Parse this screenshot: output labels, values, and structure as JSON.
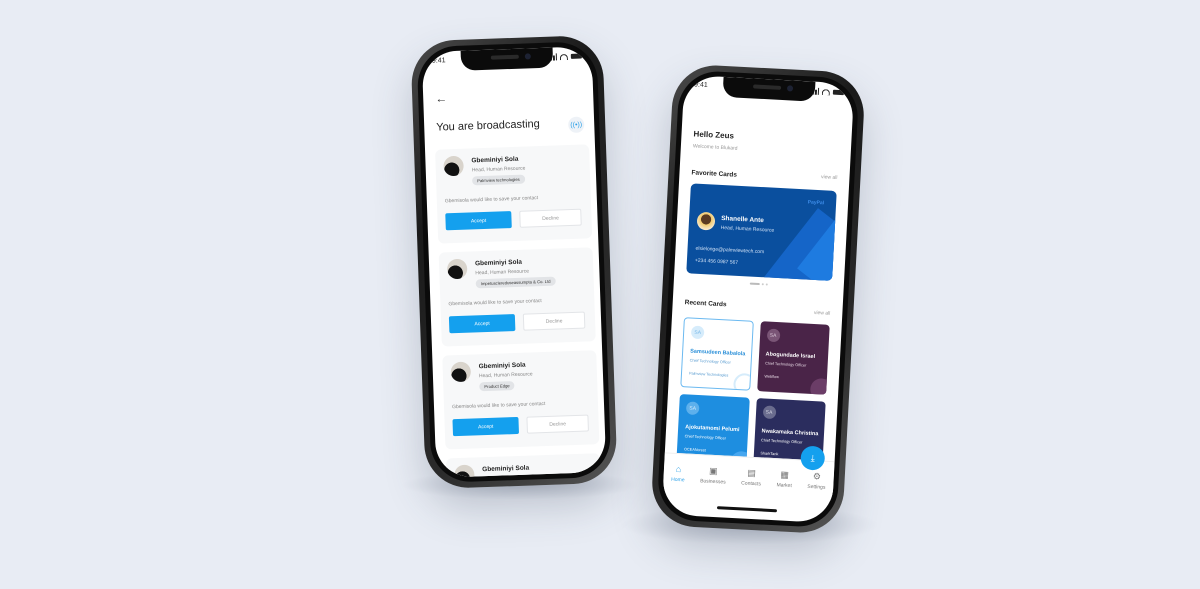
{
  "status_bar": {
    "time": "9:41"
  },
  "broadcast_screen": {
    "back_label": "←",
    "title": "You are broadcasting",
    "broadcast_icon": "((•))",
    "requests": [
      {
        "name": "Gbeminiyi Sola",
        "role": "Head, Human Resource",
        "company": "Palmview technologies",
        "message": "Gbemisola would like to save your contact",
        "accept_label": "Accept",
        "decline_label": "Decline"
      },
      {
        "name": "Gbeminiyi Sola",
        "role": "Head, Human Resource",
        "company": "Impetusclereduseassumpta & Co. Ltd",
        "message": "Gbemisola would like to save your contact",
        "accept_label": "Accept",
        "decline_label": "Decline"
      },
      {
        "name": "Gbeminiyi Sola",
        "role": "Head, Human Resource",
        "company": "Product Edge",
        "message": "Gbemisola would like to save your contact",
        "accept_label": "Accept",
        "decline_label": "Decline"
      },
      {
        "name": "Gbeminiyi Sola"
      }
    ]
  },
  "home_screen": {
    "greeting": "Hello Zeus",
    "welcome": "Welcome to Blukard",
    "favorite_title": "Favorite Cards",
    "favorite_view_all": "view all",
    "favorite_card": {
      "brand": "PayPal",
      "name": "Shanelle Ante",
      "role": "Head, Human Resource",
      "email": "elsielonge@palmviewtech.com",
      "phone": "+234 456 0987 567",
      "colors": {
        "background": "#0a4f9e"
      }
    },
    "recent_title": "Recent Cards",
    "recent_view_all": "view all",
    "recent_cards": [
      {
        "initials": "SA",
        "name": "Samsudeen Babalola",
        "role": "Chief Technology Officer",
        "company": "Palmview Technologies",
        "color": "#ffffff"
      },
      {
        "initials": "SA",
        "name": "Abogundade Israel",
        "role": "Chief Technology Officer",
        "company": "Webflow",
        "color": "#4a2448"
      },
      {
        "initials": "SA",
        "name": "Ajokutamomi Pelumi",
        "role": "Chief Technology Officer",
        "company": "OCEANcrest",
        "color": "#1e8ee0"
      },
      {
        "initials": "SA",
        "name": "Nwakamaka Christina",
        "role": "Chief Technology Officer",
        "company": "SharkTank",
        "color": "#2b2d5e"
      }
    ],
    "fab_icon": "⤓",
    "tabs": [
      {
        "label": "Home",
        "icon": "⌂",
        "active": true
      },
      {
        "label": "Businesses",
        "icon": "▣"
      },
      {
        "label": "Contacts",
        "icon": "▤"
      },
      {
        "label": "Market",
        "icon": "▦"
      },
      {
        "label": "Settings",
        "icon": "⚙"
      }
    ]
  },
  "colors": {
    "accent": "#14a0ee",
    "background": "#e8ecf4"
  }
}
